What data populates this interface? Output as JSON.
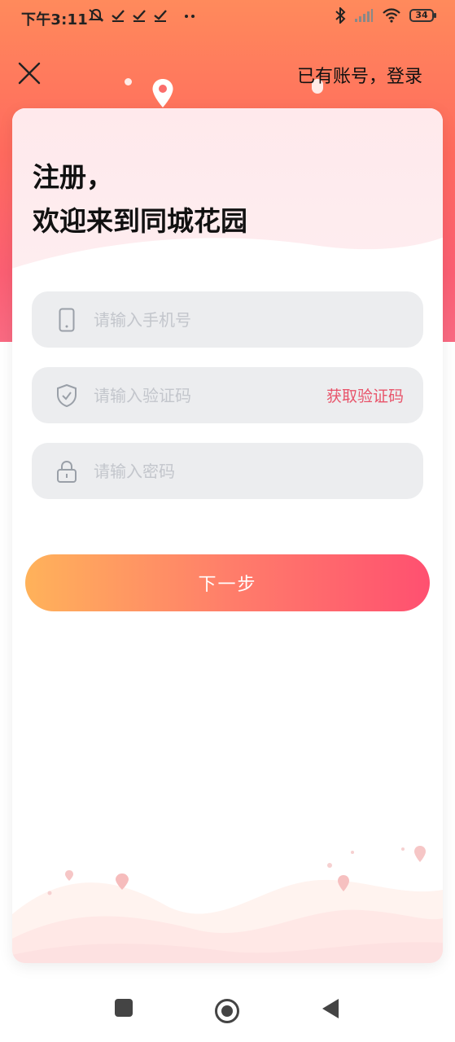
{
  "status_bar": {
    "time": "下午3:11",
    "battery": "34",
    "icons": [
      "mute-icon",
      "check-icon",
      "check-icon",
      "check-icon",
      "more-dots-icon",
      "bluetooth-icon",
      "signal-icon",
      "wifi-icon",
      "battery-icon"
    ]
  },
  "header": {
    "close_icon": "close-icon",
    "login_link": "已有账号，登录"
  },
  "title": {
    "line1": "注册，",
    "line2": "欢迎来到同城花园"
  },
  "form": {
    "phone": {
      "icon": "phone-icon",
      "placeholder": "请输入手机号",
      "value": ""
    },
    "code": {
      "icon": "shield-check-icon",
      "placeholder": "请输入验证码",
      "value": "",
      "get_code_label": "获取验证码"
    },
    "password": {
      "icon": "lock-icon",
      "placeholder": "请输入密码",
      "value": ""
    }
  },
  "next_button": "下一步",
  "nav_bar": {
    "items": [
      "recent-apps-icon",
      "home-icon",
      "back-icon"
    ]
  },
  "colors": {
    "gradient_top": "#ff8a5c",
    "gradient_bottom": "#f96a82",
    "accent": "#e8546a",
    "button_start": "#ffb25a",
    "button_end": "#ff5070",
    "input_bg": "#ecedef"
  }
}
